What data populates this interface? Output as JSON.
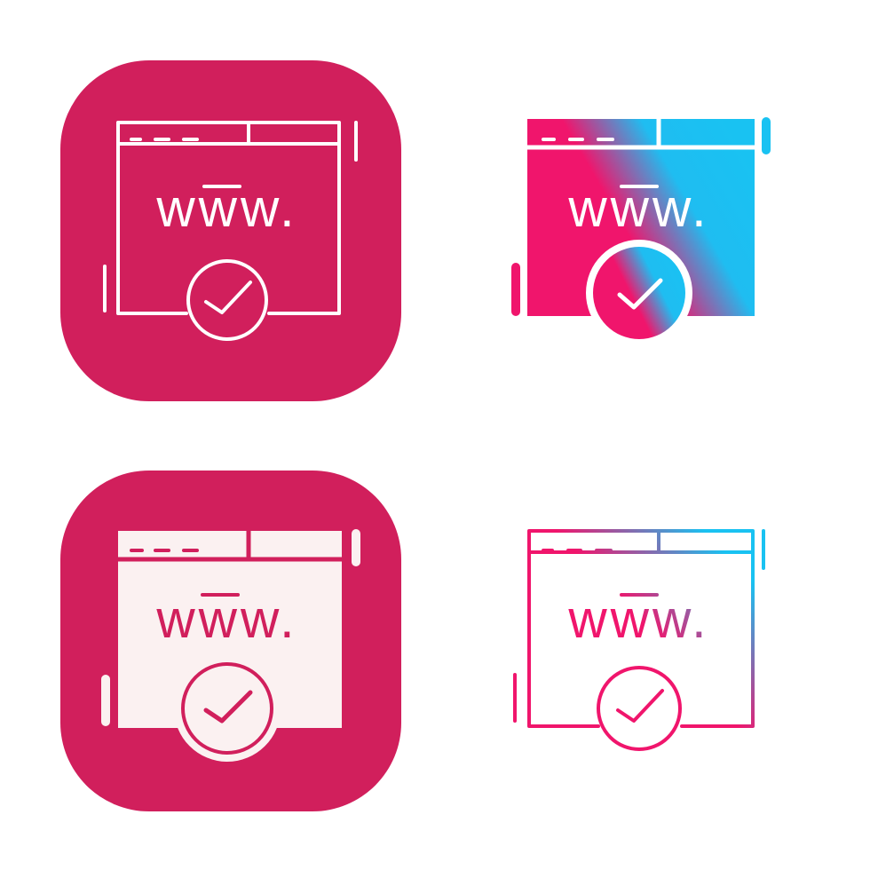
{
  "icon_set": {
    "name": "website-verified-icon",
    "address_text": "www.",
    "colors": {
      "brand_crimson": "#d11f5c",
      "white": "#ffffff",
      "gradient_pink": "#f0156c",
      "gradient_blue": "#19c2f2"
    },
    "variants": [
      {
        "id": "line-on-badge",
        "style": "white outline on crimson rounded square",
        "icon": "browser-window-checkmark-icon"
      },
      {
        "id": "gradient-glyph",
        "style": "filled pink-to-blue gradient",
        "icon": "browser-window-checkmark-icon"
      },
      {
        "id": "glyph-on-badge",
        "style": "white filled glyph on crimson rounded square",
        "icon": "browser-window-checkmark-icon"
      },
      {
        "id": "gradient-line",
        "style": "pink-to-blue gradient outline",
        "icon": "browser-window-checkmark-icon"
      }
    ]
  }
}
